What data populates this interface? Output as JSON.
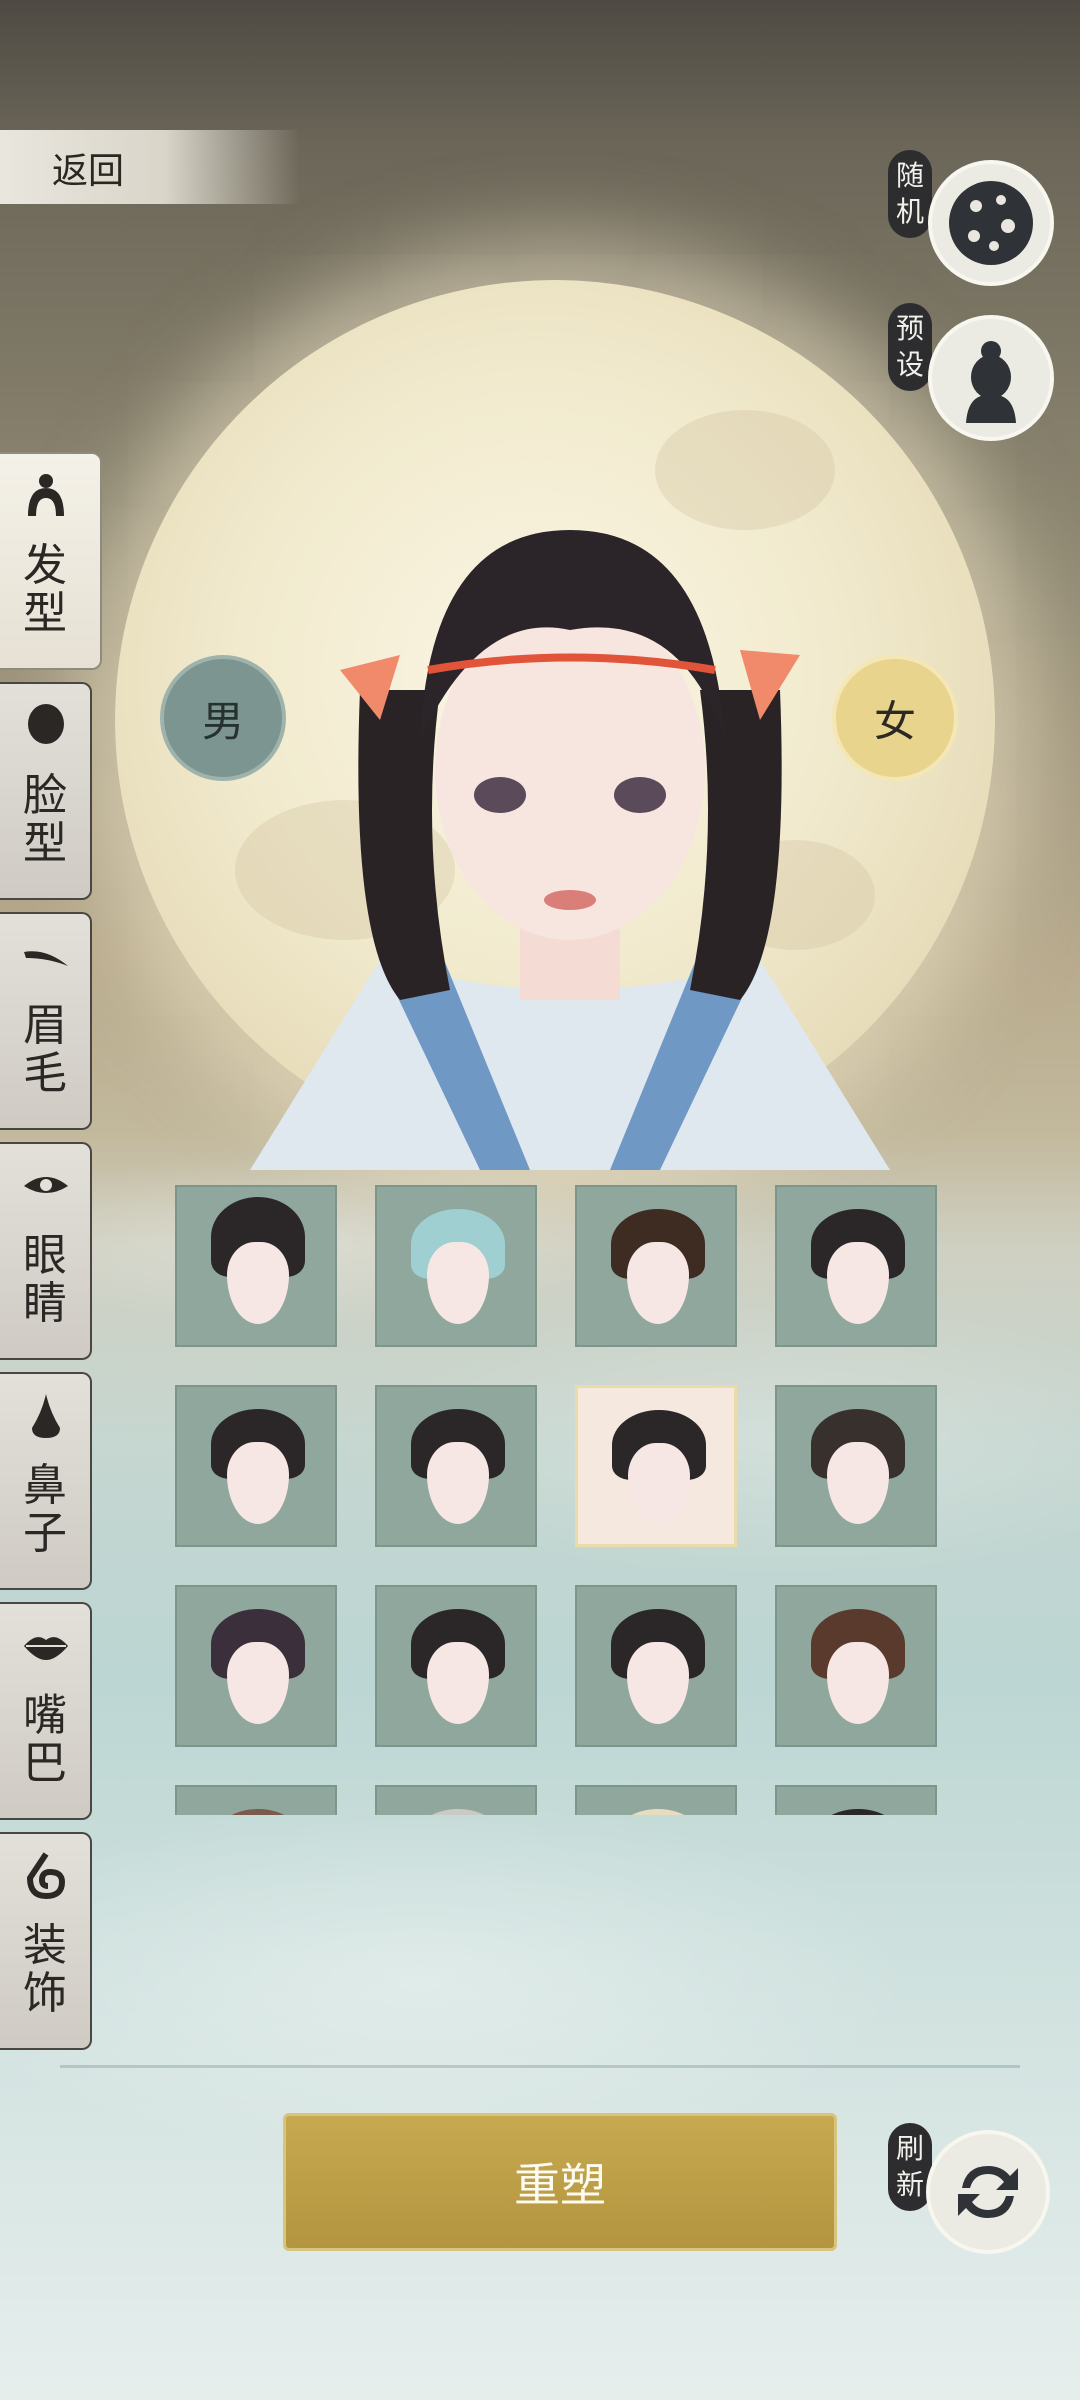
{
  "header": {
    "back_label": "返回"
  },
  "right_actions": [
    {
      "label": "随机",
      "icon": "dice-icon"
    },
    {
      "label": "预设",
      "icon": "portrait-silhouette-icon"
    }
  ],
  "gender": {
    "male": "男",
    "female": "女",
    "selected": "female"
  },
  "tabs": [
    {
      "label": "发型",
      "icon": "hair-bun-icon",
      "active": true
    },
    {
      "label": "脸型",
      "icon": "head-icon",
      "active": false
    },
    {
      "label": "眉毛",
      "icon": "eyebrow-icon",
      "active": false
    },
    {
      "label": "眼睛",
      "icon": "eye-icon",
      "active": false
    },
    {
      "label": "鼻子",
      "icon": "nose-icon",
      "active": false
    },
    {
      "label": "嘴巴",
      "icon": "lips-icon",
      "active": false
    },
    {
      "label": "装饰",
      "icon": "ornament-icon",
      "active": false
    }
  ],
  "hair_grid": {
    "selected_index": 6,
    "count": 16
  },
  "footer": {
    "reshape_label": "重塑",
    "refresh_label": "刷新",
    "refresh_icon": "refresh-arrows-icon"
  }
}
